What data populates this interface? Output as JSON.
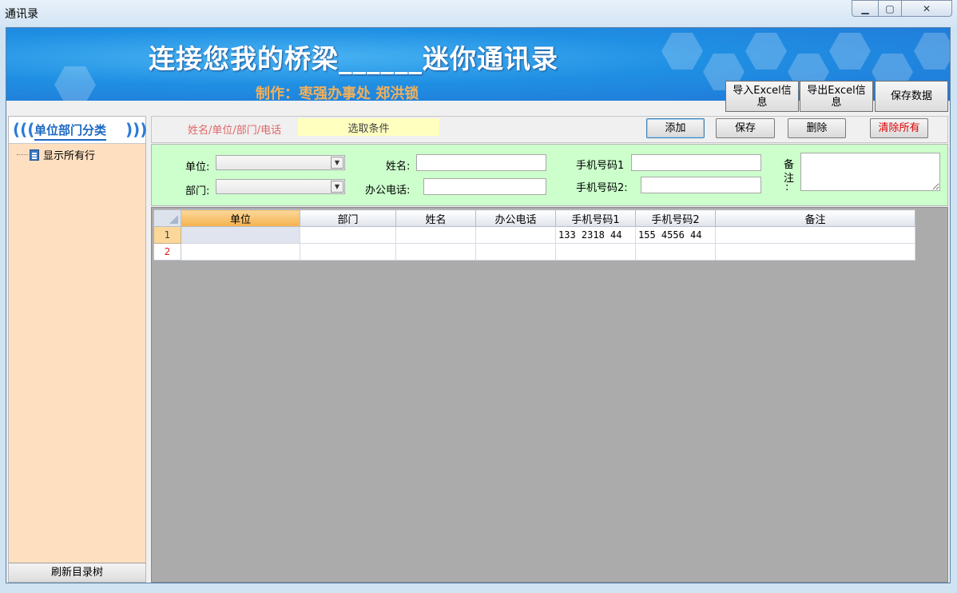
{
  "window": {
    "title": "通讯录",
    "min_glyph": "▁",
    "max_glyph": "▢",
    "close_glyph": "✕"
  },
  "banner": {
    "title": "连接您我的桥梁______迷你通讯录",
    "subtitle": "制作：枣强办事处 郑洪锁",
    "buttons": {
      "import_excel": "导入Excel信息",
      "export_excel": "导出Excel信息",
      "save_data": "保存数据"
    }
  },
  "sidebar": {
    "title": "单位部门分类",
    "tree_item": "显示所有行",
    "refresh": "刷新目录树"
  },
  "toolbar": {
    "search_hint": "姓名/单位/部门/电话",
    "search_value": "选取条件",
    "add": "添加",
    "save": "保存",
    "delete": "删除",
    "clear_all": "清除所有"
  },
  "form": {
    "unit_label": "单位:",
    "dept_label": "部门:",
    "name_label": "姓名:",
    "office_phone_label": "办公电话:",
    "mobile1_label": "手机号码1",
    "mobile2_label": "手机号码2:",
    "note_label_1": "备",
    "note_label_2": "注",
    "note_label_3": ":"
  },
  "grid": {
    "columns": [
      "单位",
      "部门",
      "姓名",
      "办公电话",
      "手机号码1",
      "手机号码2",
      "备注"
    ],
    "rows": [
      {
        "num": "1",
        "cells": [
          "",
          "",
          "",
          "",
          "133 2318 44",
          "155 4556 44",
          ""
        ]
      },
      {
        "num": "2",
        "cells": [
          "",
          "",
          "",
          "",
          "",
          "",
          ""
        ]
      }
    ]
  },
  "colors": {
    "sidebar_bg": "#fee0c1",
    "form_bg": "#ccffcc",
    "search_bg": "#ffffc0",
    "clear_text": "#e00000",
    "banner_blue": "#1f8fe3"
  }
}
